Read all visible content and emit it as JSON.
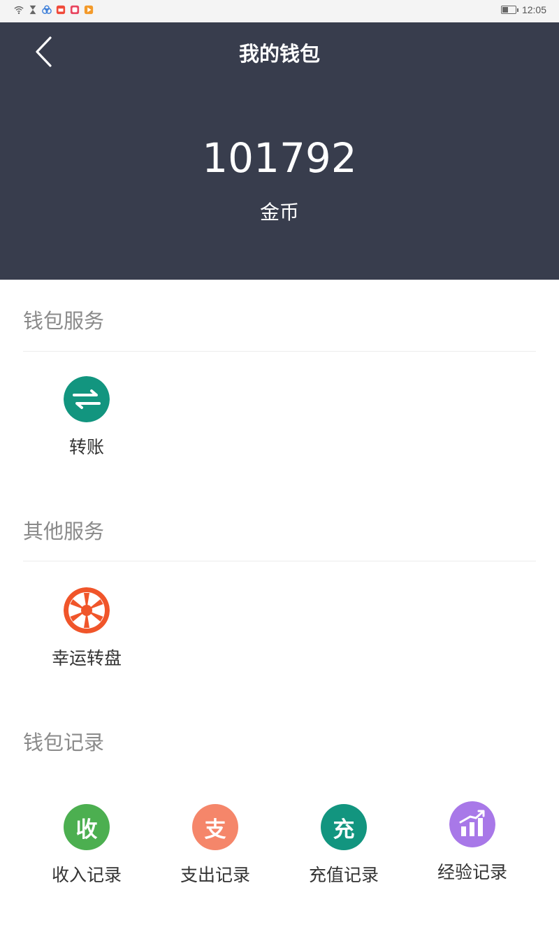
{
  "status_bar": {
    "time": "12:05",
    "battery_level": 0.45
  },
  "header": {
    "title": "我的钱包",
    "balance": "101792",
    "unit": "金币"
  },
  "sections": {
    "wallet_service": {
      "title": "钱包服务",
      "items": [
        {
          "label": "转账",
          "icon": "transfer-icon",
          "color": "#12957f"
        }
      ]
    },
    "other_service": {
      "title": "其他服务",
      "items": [
        {
          "label": "幸运转盘",
          "icon": "lucky-wheel-icon",
          "color": "#f0552a"
        }
      ]
    },
    "wallet_records": {
      "title": "钱包记录",
      "items": [
        {
          "label": "收入记录",
          "glyph": "收",
          "icon": "income-icon",
          "color": "#4caf50"
        },
        {
          "label": "支出记录",
          "glyph": "支",
          "icon": "expense-icon",
          "color": "#f5866a"
        },
        {
          "label": "充值记录",
          "glyph": "充",
          "icon": "recharge-icon",
          "color": "#12957f"
        },
        {
          "label": "经验记录",
          "icon": "experience-chart-icon",
          "color": "#a878e8"
        }
      ]
    }
  }
}
